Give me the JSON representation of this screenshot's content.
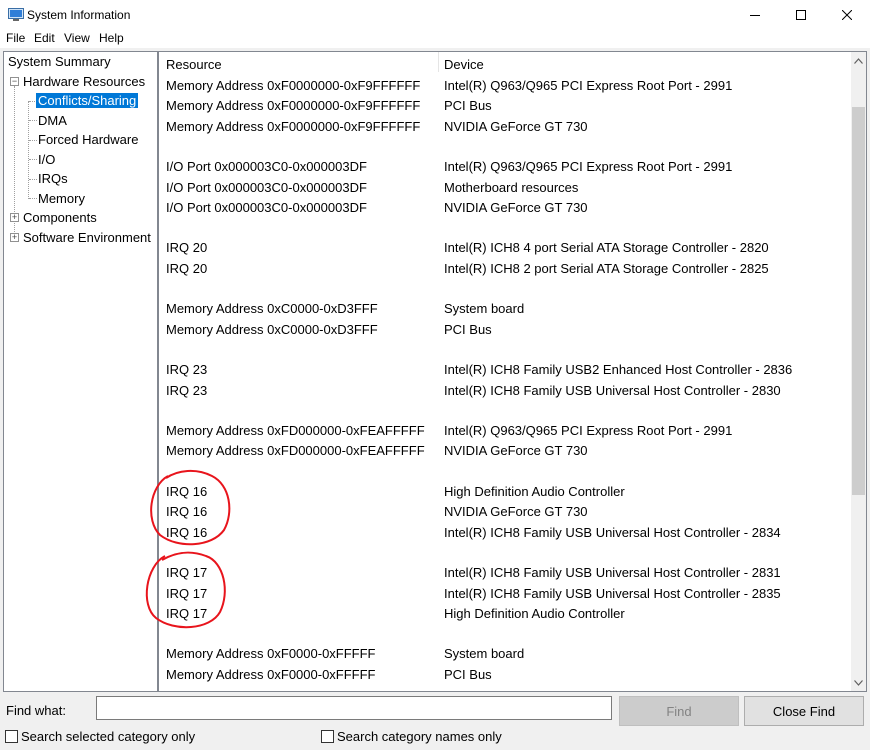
{
  "window": {
    "title": "System Information",
    "controls": {
      "minimize_icon": "minimize-icon",
      "maximize_icon": "maximize-icon",
      "close_icon": "close-icon"
    }
  },
  "menu": [
    "File",
    "Edit",
    "View",
    "Help"
  ],
  "tree": {
    "system_summary": "System Summary",
    "hardware_resources": "Hardware Resources",
    "hardware_children": [
      "Conflicts/Sharing",
      "DMA",
      "Forced Hardware",
      "I/O",
      "IRQs",
      "Memory"
    ],
    "selected": "Conflicts/Sharing",
    "components": "Components",
    "software_environment": "Software Environment"
  },
  "list": {
    "columns": [
      "Resource",
      "Device"
    ],
    "rows": [
      [
        "Memory Address 0xF0000000-0xF9FFFFFF",
        "Intel(R) Q963/Q965 PCI Express Root Port - 2991"
      ],
      [
        "Memory Address 0xF0000000-0xF9FFFFFF",
        "PCI Bus"
      ],
      [
        "Memory Address 0xF0000000-0xF9FFFFFF",
        "NVIDIA GeForce GT 730"
      ],
      [
        "",
        ""
      ],
      [
        "I/O Port 0x000003C0-0x000003DF",
        "Intel(R) Q963/Q965 PCI Express Root Port - 2991"
      ],
      [
        "I/O Port 0x000003C0-0x000003DF",
        "Motherboard resources"
      ],
      [
        "I/O Port 0x000003C0-0x000003DF",
        "NVIDIA GeForce GT 730"
      ],
      [
        "",
        ""
      ],
      [
        "IRQ 20",
        "Intel(R) ICH8 4 port Serial ATA Storage Controller - 2820"
      ],
      [
        "IRQ 20",
        "Intel(R) ICH8 2 port Serial ATA Storage Controller - 2825"
      ],
      [
        "",
        ""
      ],
      [
        "Memory Address 0xC0000-0xD3FFF",
        "System board"
      ],
      [
        "Memory Address 0xC0000-0xD3FFF",
        "PCI Bus"
      ],
      [
        "",
        ""
      ],
      [
        "IRQ 23",
        "Intel(R) ICH8 Family USB2 Enhanced Host Controller - 2836"
      ],
      [
        "IRQ 23",
        "Intel(R) ICH8 Family USB Universal Host Controller - 2830"
      ],
      [
        "",
        ""
      ],
      [
        "Memory Address 0xFD000000-0xFEAFFFFF",
        "Intel(R) Q963/Q965 PCI Express Root Port - 2991"
      ],
      [
        "Memory Address 0xFD000000-0xFEAFFFFF",
        "NVIDIA GeForce GT 730"
      ],
      [
        "",
        ""
      ],
      [
        "IRQ 16",
        "High Definition Audio Controller"
      ],
      [
        "IRQ 16",
        "NVIDIA GeForce GT 730"
      ],
      [
        "IRQ 16",
        "Intel(R) ICH8 Family USB Universal Host Controller - 2834"
      ],
      [
        "",
        ""
      ],
      [
        "IRQ 17",
        "Intel(R) ICH8 Family USB Universal Host Controller - 2831"
      ],
      [
        "IRQ 17",
        "Intel(R) ICH8 Family USB Universal Host Controller - 2835"
      ],
      [
        "IRQ 17",
        "High Definition Audio Controller"
      ],
      [
        "",
        ""
      ],
      [
        "Memory Address 0xF0000-0xFFFFF",
        "System board"
      ],
      [
        "Memory Address 0xF0000-0xFFFFF",
        "PCI Bus"
      ]
    ]
  },
  "annotations": {
    "color": "#e8141c",
    "circled_groups": [
      "IRQ 16",
      "IRQ 17"
    ]
  },
  "find": {
    "label": "Find what:",
    "value": "",
    "find_button": "Find",
    "close_find_button": "Close Find",
    "search_selected_category": "Search selected category only",
    "search_category_names": "Search category names only"
  },
  "colors": {
    "selection": "#0078d7",
    "window_bg": "#f0f0f0"
  }
}
